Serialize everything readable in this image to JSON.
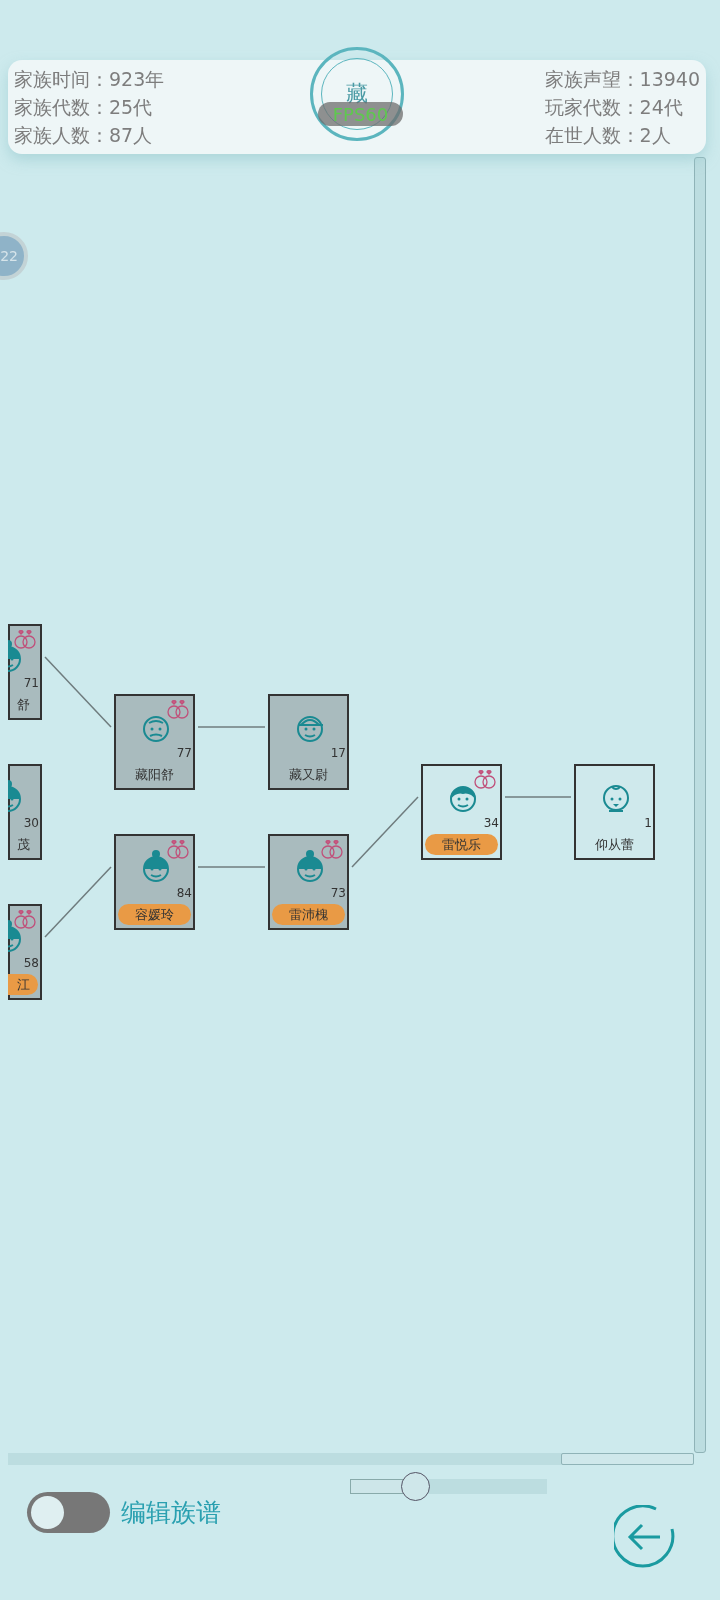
{
  "stats_left": [
    {
      "label": "家族时间：",
      "value": "923年"
    },
    {
      "label": "家族代数：",
      "value": "25代"
    },
    {
      "label": "家族人数：",
      "value": "87人"
    }
  ],
  "stats_right": [
    {
      "label": "家族声望：",
      "value": "13940"
    },
    {
      "label": "玩家代数：",
      "value": "24代"
    },
    {
      "label": "在世人数：",
      "value": "2人"
    }
  ],
  "seal": {
    "text": "藏"
  },
  "fps_badge": "FPS60",
  "side_badge": "22",
  "members": [
    {
      "clipped": true,
      "name": "舒",
      "age": "71",
      "kind": "elder_woman",
      "married": true,
      "alive": false,
      "name_tag": false
    },
    {
      "clipped": true,
      "name": "茂",
      "age": "30",
      "kind": "elder_woman",
      "married": false,
      "alive": false,
      "name_tag": false
    },
    {
      "clipped": true,
      "name": "江",
      "age": "58",
      "kind": "elder_woman",
      "married": true,
      "alive": false,
      "name_tag": true
    },
    {
      "clipped": false,
      "name": "藏阳舒",
      "age": "77",
      "kind": "elder_man",
      "married": true,
      "alive": false,
      "name_tag": false
    },
    {
      "clipped": false,
      "name": "容媛玲",
      "age": "84",
      "kind": "elder_woman",
      "married": true,
      "alive": false,
      "name_tag": true
    },
    {
      "clipped": false,
      "name": "藏又尉",
      "age": "17",
      "kind": "boy",
      "married": false,
      "alive": false,
      "name_tag": false
    },
    {
      "clipped": false,
      "name": "雷沛槐",
      "age": "73",
      "kind": "elder_woman",
      "married": true,
      "alive": false,
      "name_tag": true
    },
    {
      "clipped": false,
      "name": "雷悦乐",
      "age": "34",
      "kind": "young_woman",
      "married": true,
      "alive": true,
      "name_tag": true
    },
    {
      "clipped": false,
      "name": "仰从蕾",
      "age": "1",
      "kind": "baby",
      "married": false,
      "alive": true,
      "name_tag": false
    }
  ],
  "edit_toggle": {
    "label": "编辑族谱",
    "on": false
  },
  "zoom_slider": {
    "level": 0.33
  }
}
